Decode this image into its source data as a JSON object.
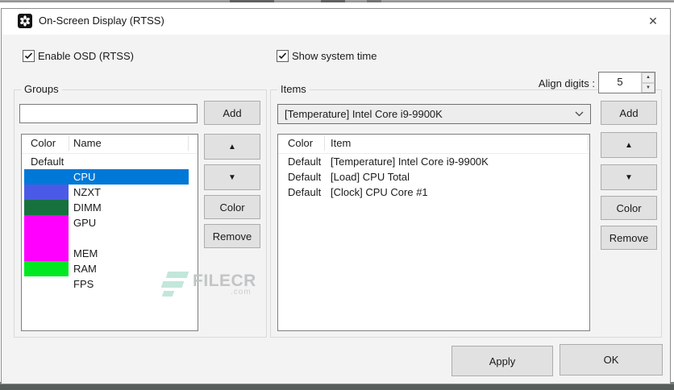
{
  "window": {
    "title": "On-Screen Display (RTSS)",
    "close_glyph": "✕"
  },
  "ui": {
    "selection_color": "#0078D7"
  },
  "toggles": {
    "enable_osd": {
      "label": "Enable OSD (RTSS)",
      "checked": true
    },
    "show_system_time": {
      "label": "Show system time",
      "checked": true
    }
  },
  "groups": {
    "label": "Groups",
    "input": {
      "value": "",
      "placeholder": ""
    },
    "buttons": {
      "add": "Add",
      "up": "▲",
      "down": "▼",
      "color": "Color",
      "remove": "Remove"
    },
    "columns": {
      "color": "Color",
      "name": "Name"
    },
    "rows": [
      {
        "color_label": "Default",
        "color": "",
        "name": ""
      },
      {
        "color_label": "",
        "color": "",
        "name": "CPU",
        "selected": true
      },
      {
        "color_label": "",
        "color": "#4B5AE6",
        "name": "NZXT"
      },
      {
        "color_label": "",
        "color": "#17713F",
        "name": "DIMM"
      },
      {
        "color_label": "",
        "color": "#FF00FF",
        "name": "GPU"
      },
      {
        "color_label": "",
        "color": "#FF00FF",
        "name": ""
      },
      {
        "color_label": "",
        "color": "#FF00FF",
        "name": "MEM"
      },
      {
        "color_label": "",
        "color": "#00E81F",
        "name": "RAM"
      },
      {
        "color_label": "",
        "color": "",
        "name": "FPS"
      }
    ]
  },
  "items": {
    "label": "Items",
    "align_digits": {
      "label": "Align digits :",
      "value": "5",
      "spin_up": "▲",
      "spin_down": "▼"
    },
    "dropdown": {
      "value": "[Temperature] Intel Core i9-9900K"
    },
    "buttons": {
      "add": "Add",
      "up": "▲",
      "down": "▼",
      "color": "Color",
      "remove": "Remove"
    },
    "columns": {
      "color": "Color",
      "item": "Item"
    },
    "rows": [
      {
        "color_label": "Default",
        "item": "[Temperature] Intel Core i9-9900K"
      },
      {
        "color_label": "Default",
        "item": "[Load] CPU Total"
      },
      {
        "color_label": "Default",
        "item": "[Clock] CPU Core #1"
      }
    ]
  },
  "footer": {
    "apply": "Apply",
    "ok": "OK"
  },
  "watermark": {
    "text": "FILECR",
    "suffix": ".com"
  }
}
